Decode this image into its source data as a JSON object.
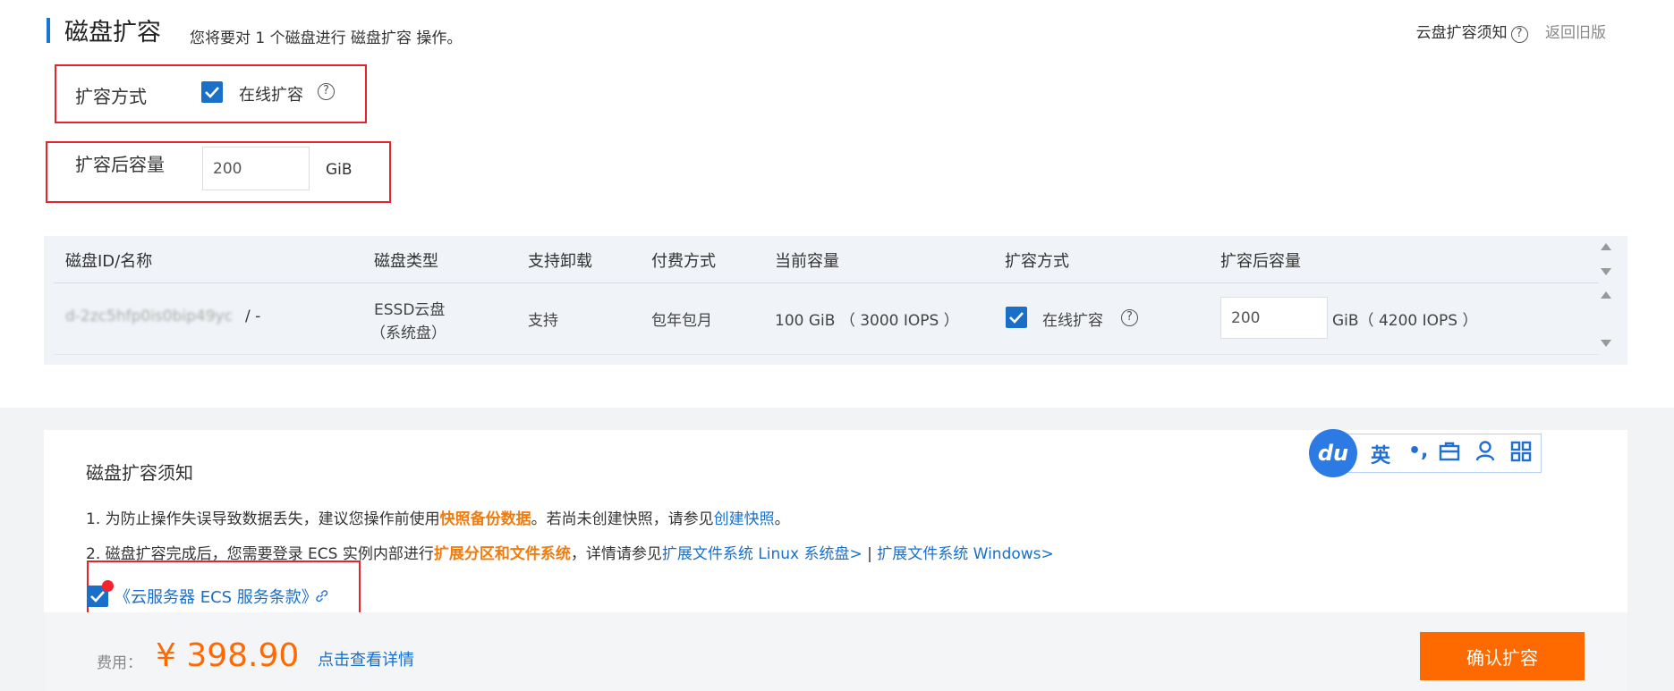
{
  "header": {
    "title": "磁盘扩容",
    "subtitle": "您将要对 1 个磁盘进行 磁盘扩容 操作。",
    "notice_link": "云盘扩容须知",
    "back_link": "返回旧版"
  },
  "form": {
    "method_label": "扩容方式",
    "online_label": "在线扩容",
    "capacity_label": "扩容后容量",
    "capacity_value": "200",
    "capacity_unit": "GiB"
  },
  "table": {
    "headers": [
      "磁盘ID/名称",
      "磁盘类型",
      "支持卸载",
      "付费方式",
      "当前容量",
      "扩容方式",
      "扩容后容量"
    ],
    "row": {
      "disk_id": "d-2zc5hfp0is0bip49yc",
      "disk_name": "/ -",
      "disk_type_1": "ESSD云盘",
      "disk_type_2": "（系统盘）",
      "detachable": "支持",
      "billing": "包年包月",
      "current_capacity": "100 GiB （ 3000 IOPS ）",
      "method": "在线扩容",
      "new_capacity": "200",
      "new_capacity_unit": "GiB（ 4200 IOPS ）"
    }
  },
  "notice": {
    "title": "磁盘扩容须知",
    "line1_a": "1. 为防止操作失误导致数据丢失，建议您操作前使用",
    "line1_b": "快照备份数据",
    "line1_c": "。若尚未创建快照，请参见",
    "line1_d": "创建快照",
    "line1_e": "。",
    "line2_a": "2. 磁盘扩容完成后，您需要登录 ECS 实例内部进行",
    "line2_b": "扩展分区和文件系统",
    "line2_c": "，详情请参见",
    "line2_d": "扩展文件系统 Linux 系统盘>",
    "line2_e": " | ",
    "line2_f": "扩展文件系统 Windows>",
    "terms": "《云服务器 ECS 服务条款》"
  },
  "footer": {
    "fee_label": "费用：",
    "price": "¥ 398.90",
    "detail_link": "点击查看详情",
    "confirm_button": "确认扩容"
  },
  "ime": {
    "logo": "du",
    "lang": "英",
    "punct": "•,",
    "colors": {
      "primary": "#1f6fd6"
    }
  },
  "colors": {
    "accent": "#1a6fc9",
    "orange": "#ff6a00",
    "highlight_border": "#e4262c"
  }
}
